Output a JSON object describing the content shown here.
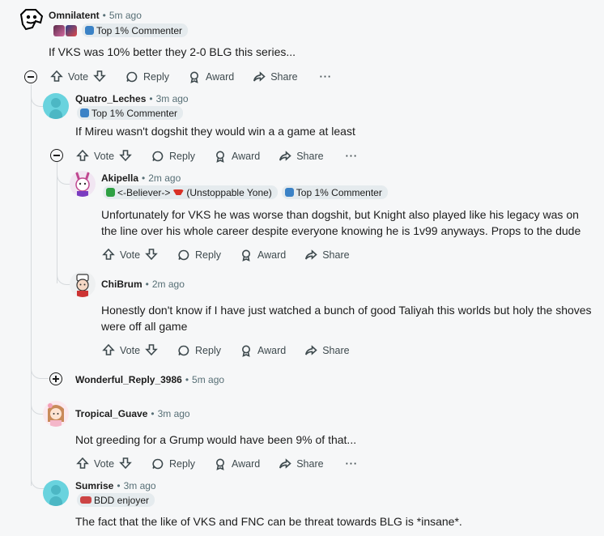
{
  "actions": {
    "vote": "Vote",
    "reply": "Reply",
    "award": "Award",
    "share": "Share",
    "more": "···"
  },
  "comments": [
    {
      "user": "Omnilatent",
      "time": "5m ago",
      "flairs": [
        "Top 1% Commenter"
      ],
      "text": "If VKS was 10% better they 2-0 BLG this series..."
    },
    {
      "user": "Quatro_Leches",
      "time": "3m ago",
      "flairs": [
        "Top 1% Commenter"
      ],
      "text": "If Mireu wasn't dogshit they would win a a game at least"
    },
    {
      "user": "Akipella",
      "time": "2m ago",
      "flairs": [
        "<-Believer->",
        "(Unstoppable Yone)",
        "Top 1% Commenter"
      ],
      "text": "Unfortunately for VKS he was worse than dogshit, but Knight also played like his legacy was on the line over his whole career despite everyone knowing he is 1v99 anyways. Props to the dude"
    },
    {
      "user": "ChiBrum",
      "time": "2m ago",
      "text": "Honestly don't know if I have just watched a bunch of good Taliyah this worlds but holy the shoves were off all game"
    },
    {
      "user": "Wonderful_Reply_3986",
      "time": "5m ago"
    },
    {
      "user": "Tropical_Guave",
      "time": "3m ago",
      "text": "Not greeding for a Grump would have been 9% of that..."
    },
    {
      "user": "Sumrise",
      "time": "3m ago",
      "flairs": [
        "BDD enjoyer"
      ],
      "text": "The fact that the like of VKS and FNC can be threat towards BLG is *insane*."
    }
  ],
  "colors": {
    "background": "#f6f7f8",
    "flair_bg": "#e5ebee",
    "thread_line": "#d6dadd",
    "avatar_teal": "#69d3de"
  }
}
